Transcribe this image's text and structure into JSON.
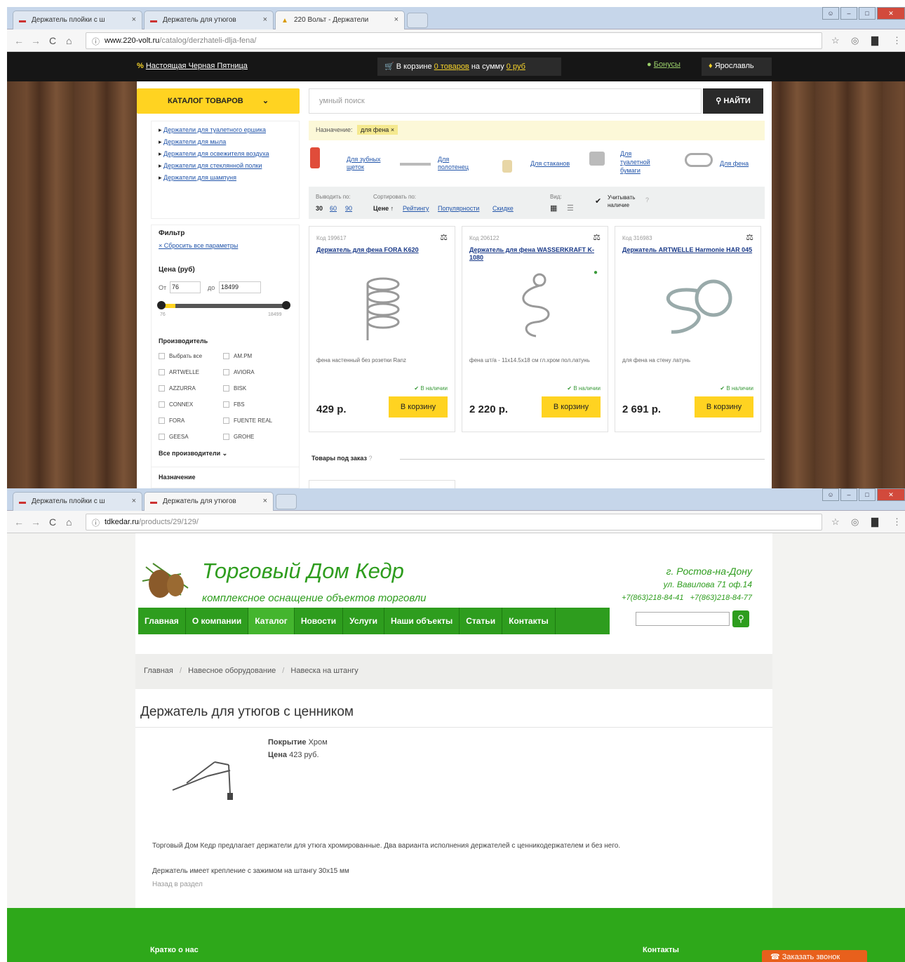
{
  "top_window": {
    "tabs": [
      {
        "label": "Держатель плойки с ш"
      },
      {
        "label": "Держатель для утюгов"
      },
      {
        "label": "220 Вольт - Держатели"
      }
    ],
    "url_domain": "www.220-volt.ru",
    "url_path": "/catalog/derzhateli-dlja-fena/",
    "topbar": {
      "promo": "Настоящая Черная Пятница",
      "cart_prefix": "В корзине",
      "cart_items": "0 товаров",
      "cart_mid": "на сумму",
      "cart_sum": "0 руб",
      "bonus": "Бонусы",
      "city": "Ярославль"
    },
    "catalog_btn": "КАТАЛОГ ТОВАРОВ",
    "search_placeholder": "умный поиск",
    "search_btn": "НАЙТИ",
    "sidebar_links": [
      "Держатели для туалетного ершика",
      "Держатели для мыла",
      "Держатели для освежителя воздуха",
      "Держатели для стеклянной полки",
      "Держатели для шампуня"
    ],
    "filter": {
      "title": "Фильтр",
      "reset": "× Сбросить все параметры",
      "price_label": "Цена (руб)",
      "from_label": "От",
      "from_val": "76",
      "to_label": "до",
      "to_val": "18499",
      "min": "76",
      "max": "18499",
      "maker_title": "Производитель",
      "makers": [
        "Выбрать все",
        "AM.PM",
        "ARTWELLE",
        "AVIORA",
        "AZZURRA",
        "BISK",
        "CONNEX",
        "FBS",
        "FORA",
        "FUENTE REAL",
        "GEESA",
        "GROHE"
      ],
      "all_makers": "Все производители",
      "purpose": "Назначение"
    },
    "purpose_bar": {
      "label": "Назначение:",
      "chip": "для фена"
    },
    "categories": [
      {
        "label": "Для зубных щеток"
      },
      {
        "label": "Для полотенец"
      },
      {
        "label": "Для стаканов"
      },
      {
        "label": "Для туалетной бумаги"
      },
      {
        "label": "Для фена"
      }
    ],
    "sortbar": {
      "show_label": "Выводить по:",
      "show": [
        "30",
        "60",
        "90"
      ],
      "sort_label": "Сортировать по:",
      "sort": [
        "Цене",
        "Рейтингу",
        "Популярности",
        "Скидке"
      ],
      "view_label": "Вид:",
      "stock": "Учитывать наличие"
    },
    "products": [
      {
        "code": "Код 199617",
        "title": "Держатель для фена FORA K620",
        "desc": "фена настенный без розетки Ranz",
        "stock": "В наличии",
        "price": "429 р.",
        "buy": "В корзину"
      },
      {
        "code": "Код 206122",
        "title": "Держатель для фена WASSERKRAFT K-1080",
        "desc": "фена шт/а - 11x14.5x18 см гл.хром пол.латунь",
        "stock": "В наличии",
        "price": "2 220 р.",
        "buy": "В корзину"
      },
      {
        "code": "Код 316983",
        "title": "Держатель ARTWELLE Harmonie HAR 045",
        "desc": "для фена на стену латунь",
        "stock": "В наличии",
        "price": "2 691 р.",
        "buy": "В корзину"
      }
    ],
    "to_order": "Товары под заказ"
  },
  "bottom_window": {
    "tabs": [
      {
        "label": "Держатель плойки с ш"
      },
      {
        "label": "Держатель для утюгов"
      }
    ],
    "url_domain": "tdkedar.ru",
    "url_path": "/products/29/129/",
    "logo_title": "Торговый Дом Кедр",
    "logo_sub": "комплексное оснащение объектов торговли",
    "city": "г. Ростов-на-Дону",
    "address": "ул. Вавилова 71 оф.14",
    "phones": "+7(863)218-84-41   +7(863)218-84-77",
    "menu": [
      "Главная",
      "О компании",
      "Каталог",
      "Новости",
      "Услуги",
      "Наши объекты",
      "Статьи",
      "Контакты"
    ],
    "breadcrumb": [
      "Главная",
      "Навесное оборудование",
      "Навеска на штангу"
    ],
    "h1": "Держатель для утюгов с ценником",
    "spec_cover_label": "Покрытие",
    "spec_cover": "Хром",
    "spec_price_label": "Цена",
    "spec_price": "423 руб.",
    "desc1": "Торговый Дом Кедр предлагает держатели для утюга хромированные. Два варианта исполнения держателей с ценникодержателем и без него.",
    "desc2": "Держатель имеет крепление с зажимом на штангу 30x15 мм",
    "back": "Назад в раздел",
    "footer_left": "Кратко о нас",
    "footer_right": "Контакты",
    "callback": "Заказать звонок"
  },
  "colors": {
    "volt_yellow": "#ffd321",
    "kedr_green": "#2e9d1e",
    "footer_green": "#2ea81a"
  }
}
